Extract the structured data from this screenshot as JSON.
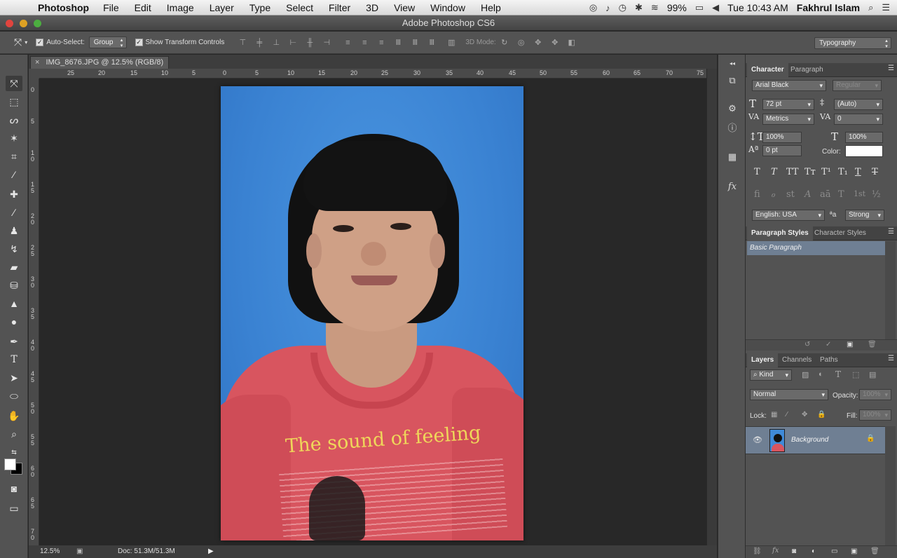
{
  "menubar": {
    "app_name": "Photoshop",
    "items": [
      "File",
      "Edit",
      "Image",
      "Layer",
      "Type",
      "Select",
      "Filter",
      "3D",
      "View",
      "Window",
      "Help"
    ],
    "battery": "99%",
    "clock": "Tue 10:43 AM",
    "user": "Fakhrul Islam"
  },
  "window": {
    "title": "Adobe Photoshop CS6"
  },
  "options": {
    "auto_select_label": "Auto-Select:",
    "auto_select_value": "Group",
    "transform_label": "Show Transform Controls",
    "mode_3d_label": "3D Mode:",
    "workspace": "Typography"
  },
  "document": {
    "tab_title": "IMG_8676.JPG @ 12.5% (RGB/8)",
    "zoom": "12.5%",
    "doc_size": "Doc: 51.3M/51.3M",
    "h_ruler": [
      "25",
      "20",
      "15",
      "10",
      "5",
      "0",
      "5",
      "10",
      "15",
      "20",
      "25",
      "30",
      "35",
      "40",
      "45",
      "50",
      "55",
      "60",
      "65",
      "70",
      "75"
    ],
    "v_ruler": [
      "0",
      "5",
      "1\n0",
      "1\n5",
      "2\n0",
      "2\n5",
      "3\n0",
      "3\n5",
      "4\n0",
      "4\n5",
      "5\n0",
      "5\n5",
      "6\n0",
      "6\n5",
      "7\n0"
    ],
    "shirt_text": "The sound of feeling"
  },
  "character": {
    "tab": "Character",
    "tab2": "Paragraph",
    "font_family": "Arial Black",
    "font_style": "Regular",
    "size": "72 pt",
    "leading": "(Auto)",
    "kerning": "Metrics",
    "tracking": "0",
    "v_scale": "100%",
    "h_scale": "100%",
    "baseline": "0 pt",
    "color_label": "Color:",
    "color_value": "#ffffff",
    "language": "English: USA",
    "antialias_glyph": "ªa",
    "antialias": "Strong"
  },
  "styles": {
    "tab": "Paragraph Styles",
    "tab2": "Character Styles",
    "item": "Basic Paragraph"
  },
  "layers": {
    "tab": "Layers",
    "tab2": "Channels",
    "tab3": "Paths",
    "filter": "Kind",
    "blend": "Normal",
    "opacity_label": "Opacity:",
    "opacity": "100%",
    "lock_label": "Lock:",
    "fill_label": "Fill:",
    "fill": "100%",
    "layer_name": "Background"
  }
}
